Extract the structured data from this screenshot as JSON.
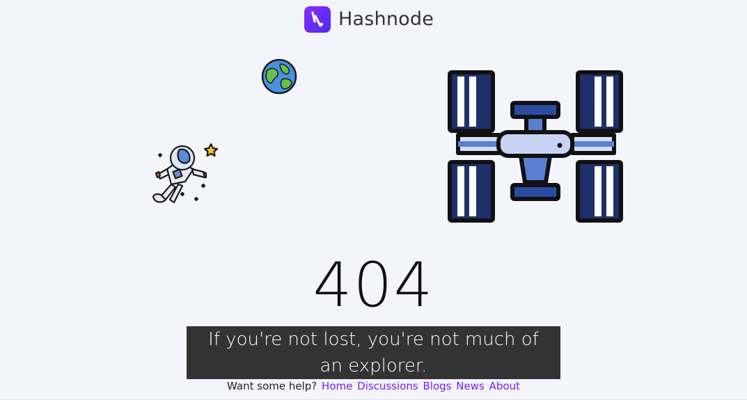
{
  "header": {
    "brand": "Hashnode"
  },
  "error": {
    "code": "404",
    "message": "If you're not lost, you're not much of an explorer."
  },
  "help": {
    "prompt": "Want some help?",
    "links": [
      "Home",
      "Discussions",
      "Blogs",
      "News",
      "About"
    ]
  },
  "icons": {
    "logo": "hashnode-logo-icon",
    "earth": "earth-icon",
    "astronaut": "astronaut-icon",
    "station": "space-station-icon"
  },
  "colors": {
    "brand": "#7a1bff",
    "background": "#f4f4fb",
    "message_bg": "#333333"
  }
}
